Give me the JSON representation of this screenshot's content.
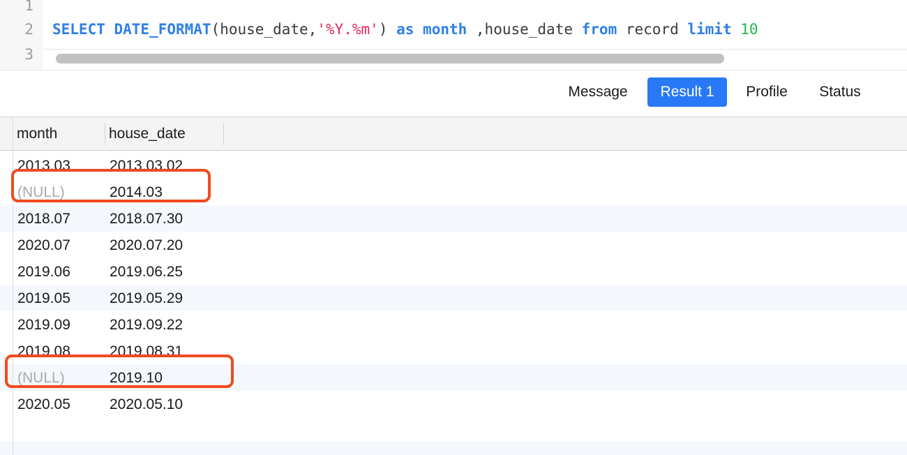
{
  "editor": {
    "lines": [
      {
        "num": "1",
        "tokens": []
      },
      {
        "num": "2",
        "tokens": [
          {
            "t": "SELECT",
            "k": "kw"
          },
          {
            "t": " DATE_FORMAT",
            "k": "kw"
          },
          {
            "t": "(house_date,",
            "k": "plain"
          },
          {
            "t": "'%Y.%m'",
            "k": "str"
          },
          {
            "t": ") ",
            "k": "plain"
          },
          {
            "t": "as",
            "k": "kw"
          },
          {
            "t": " month",
            "k": "kw"
          },
          {
            "t": " ,house_date ",
            "k": "plain"
          },
          {
            "t": "from",
            "k": "kw"
          },
          {
            "t": " record ",
            "k": "plain"
          },
          {
            "t": "limit",
            "k": "kw"
          },
          {
            "t": " 10",
            "k": "num"
          }
        ]
      },
      {
        "num": "3",
        "tokens": []
      }
    ]
  },
  "tabs": {
    "message": "Message",
    "result": "Result 1",
    "profile": "Profile",
    "status": "Status",
    "active": "result"
  },
  "grid": {
    "columns": [
      "month",
      "house_date"
    ],
    "rows": [
      [
        "2013.03",
        "2013.03.02"
      ],
      [
        "(NULL)",
        "2014.03"
      ],
      [
        "2018.07",
        "2018.07.30"
      ],
      [
        "2020.07",
        "2020.07.20"
      ],
      [
        "2019.06",
        "2019.06.25"
      ],
      [
        "2019.05",
        "2019.05.29"
      ],
      [
        "2019.09",
        "2019.09.22"
      ],
      [
        "2019.08",
        "2019.08.31"
      ],
      [
        "(NULL)",
        "2019.10"
      ],
      [
        "2020.05",
        "2020.05.10"
      ]
    ],
    "highlighted_rows": [
      1,
      8
    ]
  },
  "colors": {
    "keyword": "#2f7fe6",
    "string": "#e3265b",
    "number": "#22b84a",
    "active_tab": "#2979f6",
    "highlight": "#f04a1f",
    "null_text": "#a8a8a8"
  }
}
